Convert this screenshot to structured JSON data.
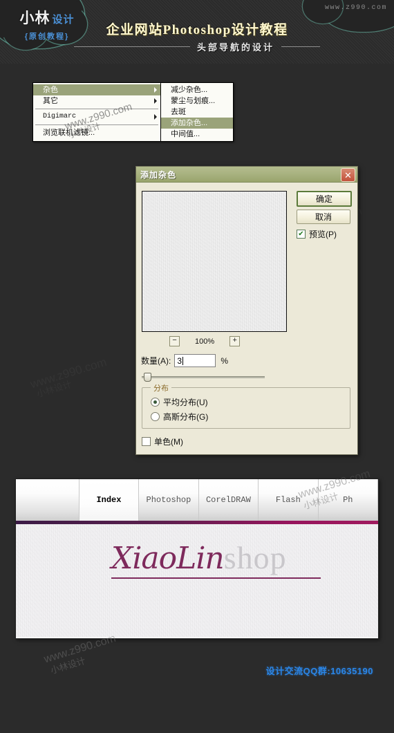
{
  "header": {
    "logo_main": "小林",
    "logo_sub": "设计",
    "logo_tagline": "{原创教程}",
    "watermark": "www.z990.com",
    "title": "企业网站Photoshop设计教程",
    "subtitle": "头部导航的设计",
    "title_color": "#fff8d0",
    "accent_color": "#4a8fd4"
  },
  "menu": {
    "left_items": [
      {
        "label": "杂色",
        "selected": true,
        "has_submenu": true
      },
      {
        "label": "其它",
        "selected": false,
        "has_submenu": true
      },
      {
        "label": "Digimarc",
        "selected": false,
        "has_submenu": true
      },
      {
        "label": "浏览联机滤镜...",
        "selected": false,
        "has_submenu": false
      }
    ],
    "right_items": [
      {
        "label": "减少杂色...",
        "selected": false
      },
      {
        "label": "蒙尘与划痕...",
        "selected": false
      },
      {
        "label": "去斑",
        "selected": false
      },
      {
        "label": "添加杂色...",
        "selected": true
      },
      {
        "label": "中间值...",
        "selected": false
      }
    ],
    "highlight_color": "#9aa37a"
  },
  "dialog": {
    "title": "添加杂色",
    "close_icon": "close-icon",
    "ok_label": "确定",
    "cancel_label": "取消",
    "preview_label": "预览(P)",
    "preview_checked": true,
    "zoom_out_icon": "−",
    "zoom_in_icon": "+",
    "zoom_value": "100%",
    "amount_label": "数量(A):",
    "amount_value": "3",
    "amount_unit": "%",
    "distribution_legend": "分布",
    "distribution_options": [
      {
        "label": "平均分布(U)",
        "selected": true
      },
      {
        "label": "高斯分布(G)",
        "selected": false
      }
    ],
    "monochrome_label": "单色(M)",
    "monochrome_checked": false,
    "titlebar_color": "#a9b381",
    "face_color": "#ece9d8"
  },
  "site_preview": {
    "nav_items": [
      {
        "label": "",
        "active": false
      },
      {
        "label": "Index",
        "active": true
      },
      {
        "label": "Photoshop",
        "active": false
      },
      {
        "label": "CorelDRAW",
        "active": false
      },
      {
        "label": "Flash",
        "active": false
      },
      {
        "label": "Ph",
        "active": false
      }
    ],
    "bar_color": "#96145c",
    "brand_primary": "XiaoLin",
    "brand_secondary": "shop",
    "brand_primary_color": "#7e2a5c",
    "brand_secondary_color": "#c9c7cb"
  },
  "watermarks": {
    "site": "www.z990.com",
    "author": "小林设计"
  },
  "footer": {
    "qq_text": "设计交流QQ群:10635190",
    "qq_color": "#2a86e8"
  }
}
